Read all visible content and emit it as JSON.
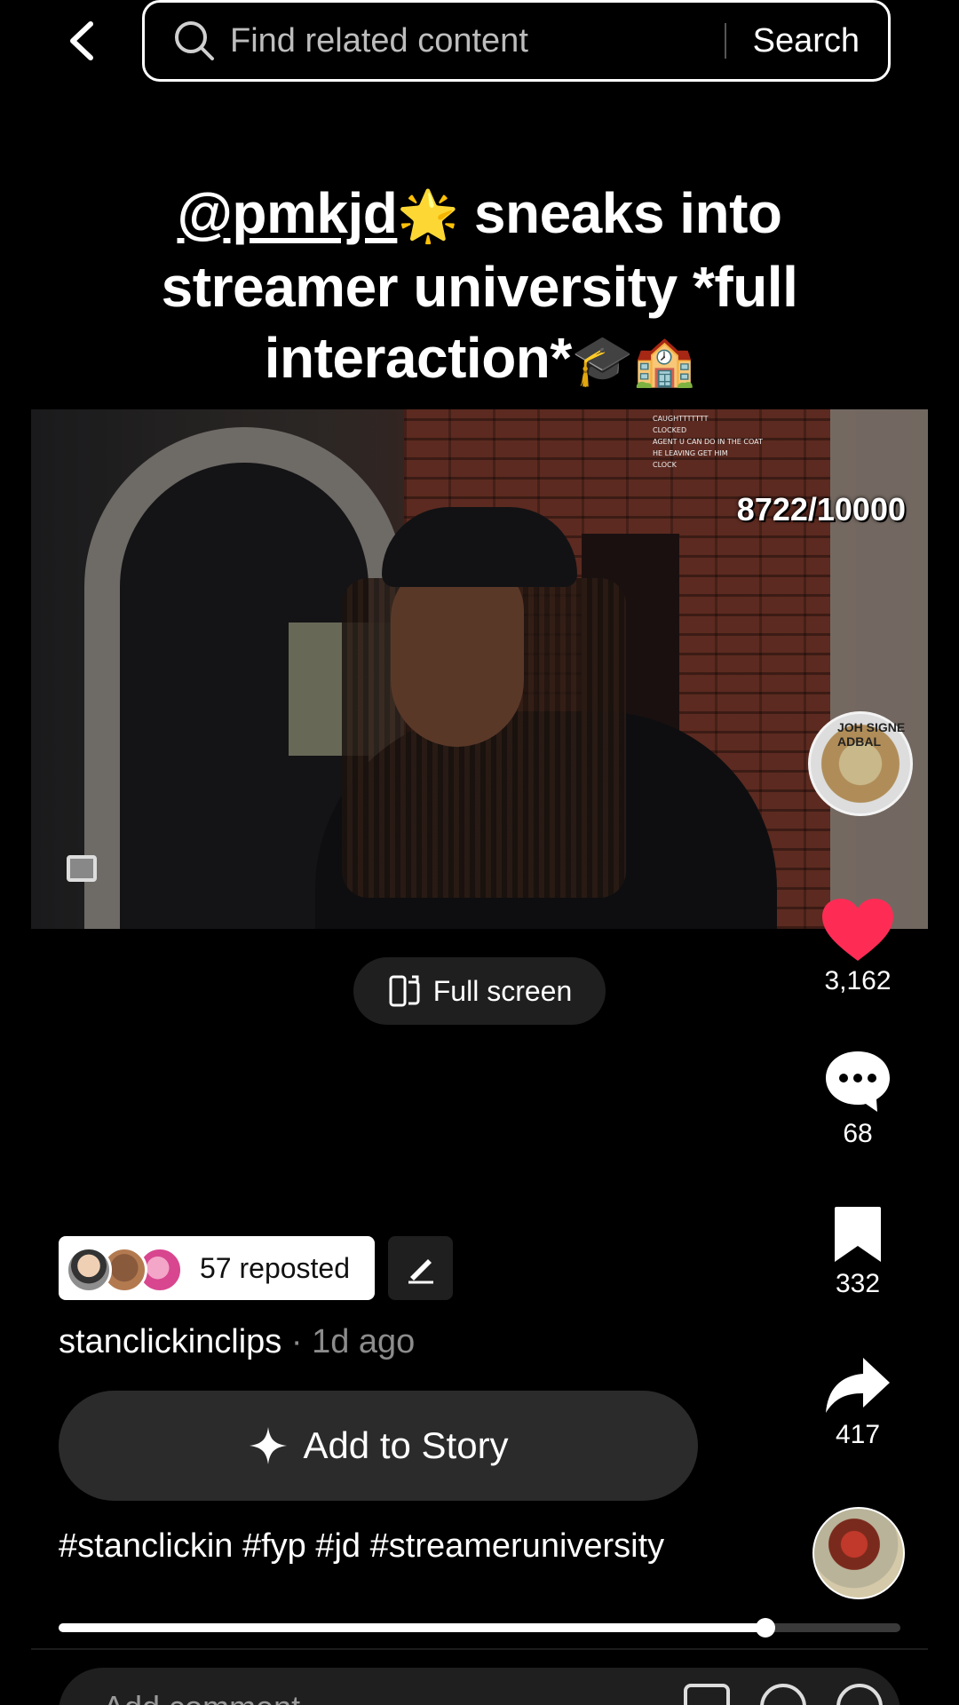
{
  "search": {
    "placeholder": "Find related content",
    "button_label": "Search"
  },
  "video": {
    "caption_mention": "@pmkjd",
    "caption_mention_emoji": "🌟",
    "caption_rest": " sneaks into streamer university *full interaction*",
    "caption_emojis": "🎓🏫",
    "counter": "8722/10000",
    "chat_lines": [
      "CAUGHTTTTTTT",
      "CLOCKED",
      "AGENT U CAN DO IN THE COAT",
      "HE LEAVING GET HIM",
      "CLOCK"
    ],
    "sound_disc_label": "JOH SIGNE ADBAL"
  },
  "fullscreen_label": "Full screen",
  "actions": {
    "likes": "3,162",
    "comments": "68",
    "bookmarks": "332",
    "shares": "417",
    "like_color": "#fe2c55"
  },
  "repost": {
    "label": "57 reposted"
  },
  "author": {
    "name": "stanclickinclips",
    "time": " · 1d ago"
  },
  "story_button_label": "Add to Story",
  "hashtags": "#stanclickin #fyp #jd #streameruniversity",
  "progress": {
    "fraction": 0.84
  },
  "comment_bar": {
    "placeholder": "Add comment..."
  }
}
